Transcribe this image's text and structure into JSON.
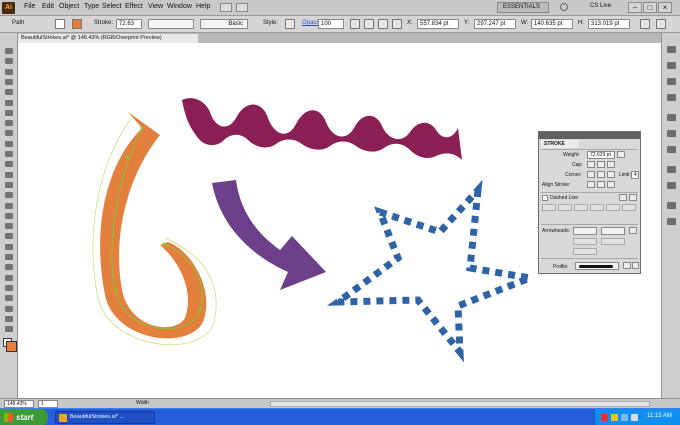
{
  "app": {
    "logo": "Ai",
    "menus": [
      "File",
      "Edit",
      "Object",
      "Type",
      "Select",
      "Effect",
      "View",
      "Window",
      "Help"
    ],
    "workspace": "ESSENTIALS",
    "cs_live": "CS Live",
    "window_controls": [
      "–",
      "□",
      "×"
    ]
  },
  "control_bar": {
    "selection_type": "Path",
    "stroke_label": "Stroke:",
    "stroke_weight": "72.63",
    "brush_label": "Basic",
    "style_label": "Style:",
    "opacity_label": "Opacity:",
    "opacity_value": "100",
    "x_label": "X:",
    "x_value": "557.834 pt",
    "y_label": "Y:",
    "y_value": "297.247 pt",
    "w_label": "W:",
    "w_value": "140.635 pt",
    "h_label": "H:",
    "h_value": "313.019 pt"
  },
  "document": {
    "tab_title": "BeautifulStrokes.ai* @ 148.43% (RGB/Overprint Preview)"
  },
  "stroke_panel": {
    "title": "STROKE",
    "weight_label": "Weight:",
    "weight_value": "72.629 pt",
    "cap_label": "Cap:",
    "corner_label": "Corner:",
    "limit_label": "Limit:",
    "limit_value": "4",
    "align_label": "Align Stroke:",
    "dashed_label": "Dashed Line",
    "arrowheads_label": "Arrowheads:",
    "profile_label": "Profile:"
  },
  "status_bar": {
    "zoom": "148.43%",
    "page": "1",
    "mode": "Width"
  },
  "taskbar": {
    "start": "start",
    "task_item": "BeautifulStrokes.ai* ...",
    "clock": "11:15 AM"
  },
  "colors": {
    "orange_stroke": "#e3803d",
    "wave_stroke": "#8a1f55",
    "arrow_fill": "#6b3f8a",
    "star_dash": "#2f63a6",
    "selection": "#7ccf3a"
  },
  "tool_icons": [
    "selection-tool-icon",
    "direct-selection-tool-icon",
    "magic-wand-icon",
    "lasso-icon",
    "pen-tool-icon",
    "type-tool-icon",
    "line-tool-icon",
    "rectangle-tool-icon",
    "paintbrush-icon",
    "pencil-icon",
    "blob-brush-icon",
    "eraser-icon",
    "rotate-tool-icon",
    "scale-tool-icon",
    "width-tool-icon",
    "free-transform-icon",
    "shape-builder-icon",
    "perspective-grid-icon",
    "mesh-tool-icon",
    "gradient-tool-icon",
    "eyedropper-icon",
    "blend-tool-icon",
    "symbol-sprayer-icon",
    "column-graph-icon",
    "artboard-tool-icon",
    "slice-tool-icon",
    "hand-tool-icon",
    "zoom-tool-icon"
  ]
}
